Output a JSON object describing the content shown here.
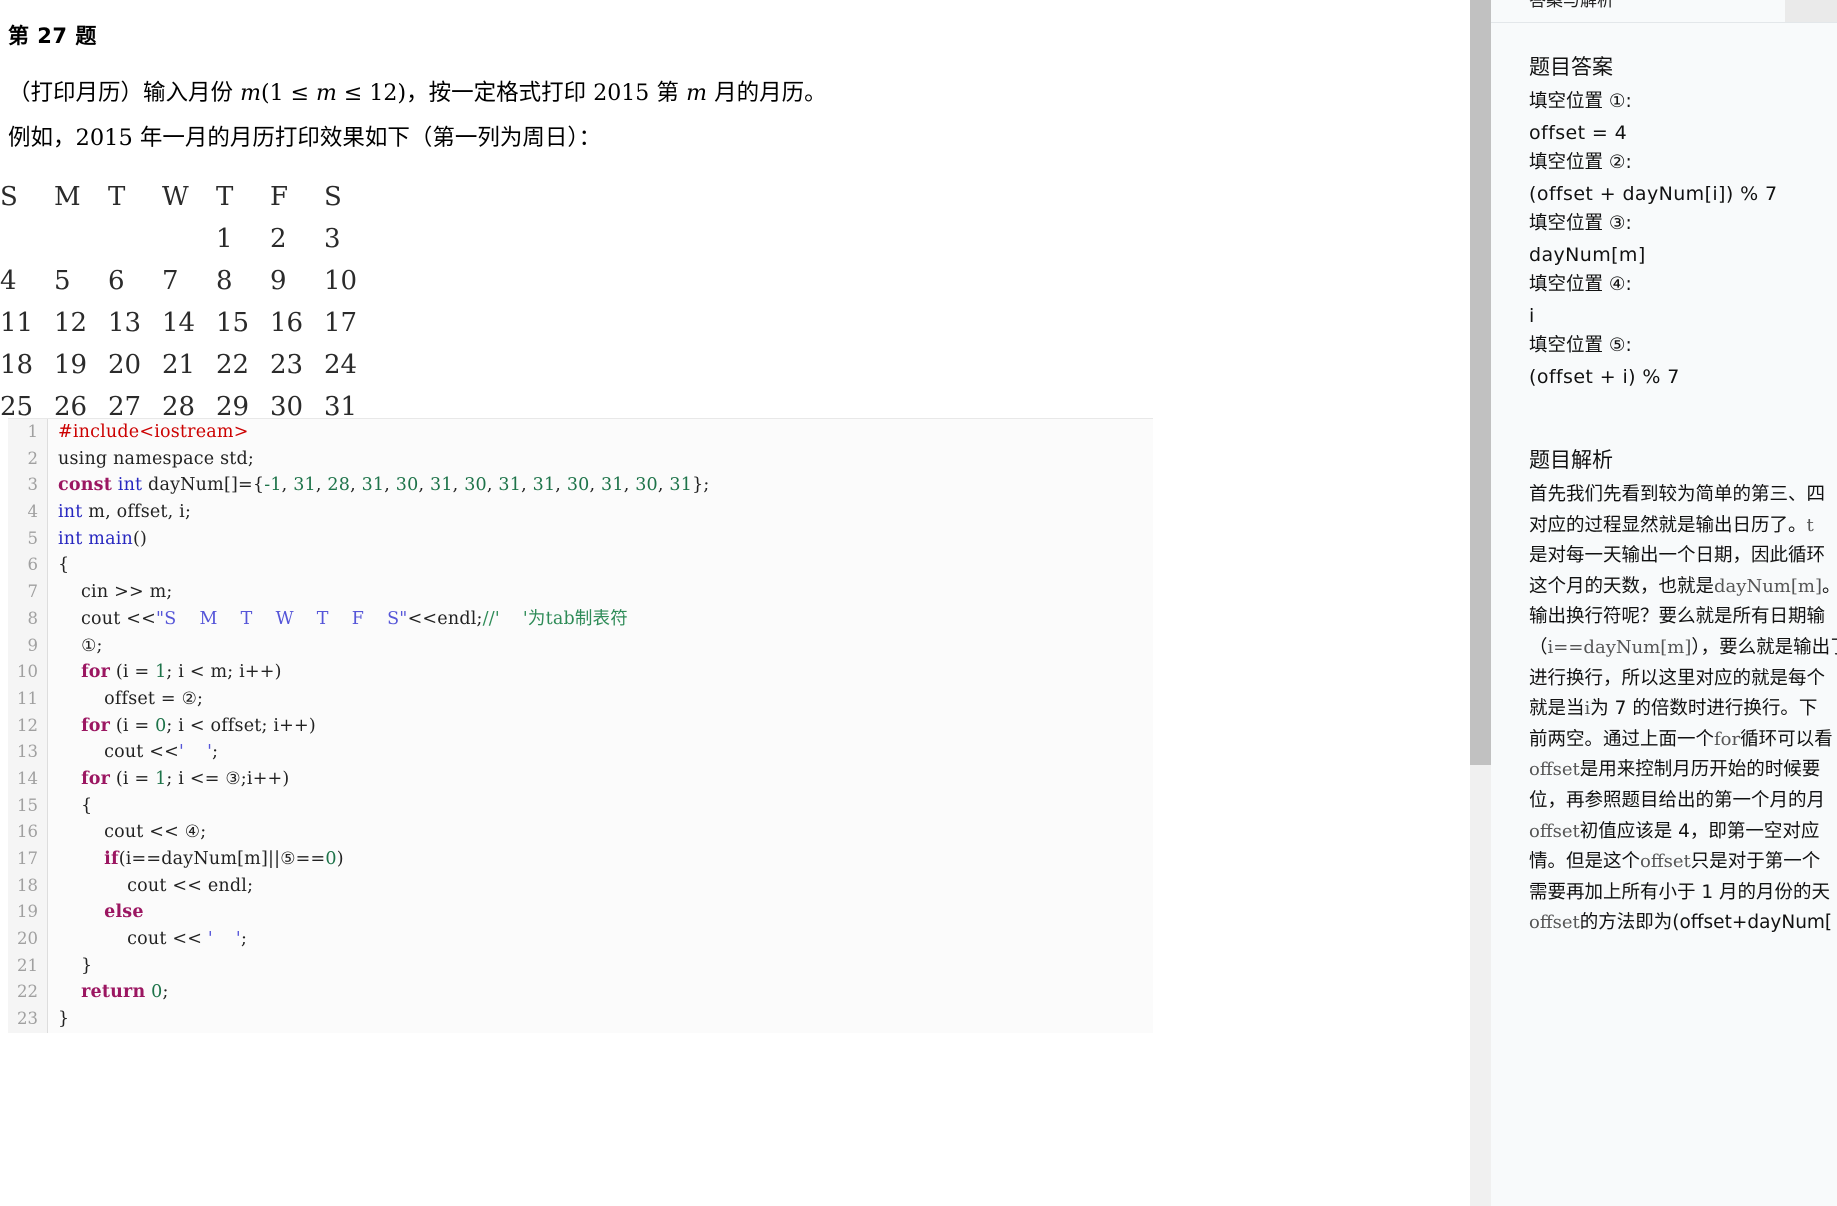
{
  "question": {
    "title": "第 27 题",
    "prompt_parts": {
      "p1_a": "（打印月历）输入月份 ",
      "p1_m": "m",
      "p1_b": "(",
      "p1_range": "1 ≤ m ≤ 12",
      "p1_c": ")，按一定格式打印 ",
      "p1_year": "2015",
      "p1_d": " 第 ",
      "p1_m2": "m",
      "p1_e": " 月的月历。"
    },
    "prompt_line2": "例如，2015 年一月的月历打印效果如下（第一列为周日）："
  },
  "calendar": {
    "header": [
      "S",
      "M",
      "T",
      "W",
      "T",
      "F",
      "S"
    ],
    "rows": [
      [
        "",
        "",
        "",
        "",
        "1",
        "2",
        "3"
      ],
      [
        "4",
        "5",
        "6",
        "7",
        "8",
        "9",
        "10"
      ],
      [
        "11",
        "12",
        "13",
        "14",
        "15",
        "16",
        "17"
      ],
      [
        "18",
        "19",
        "20",
        "21",
        "22",
        "23",
        "24"
      ],
      [
        "25",
        "26",
        "27",
        "28",
        "29",
        "30",
        "31"
      ]
    ]
  },
  "code": {
    "language": "cpp",
    "lines": [
      {
        "n": "1",
        "tokens": [
          {
            "t": "#include<iostream>",
            "c": "k-pre"
          }
        ]
      },
      {
        "n": "2",
        "tokens": [
          {
            "t": "using namespace std;",
            "c": ""
          }
        ]
      },
      {
        "n": "3",
        "tokens": [
          {
            "t": "const",
            "c": "k-kw"
          },
          {
            "t": " ",
            "c": ""
          },
          {
            "t": "int",
            "c": "k-type"
          },
          {
            "t": " dayNum[]={",
            "c": ""
          },
          {
            "t": "-1",
            "c": "k-num"
          },
          {
            "t": ", ",
            "c": ""
          },
          {
            "t": "31",
            "c": "k-num"
          },
          {
            "t": ", ",
            "c": ""
          },
          {
            "t": "28",
            "c": "k-num"
          },
          {
            "t": ", ",
            "c": ""
          },
          {
            "t": "31",
            "c": "k-num"
          },
          {
            "t": ", ",
            "c": ""
          },
          {
            "t": "30",
            "c": "k-num"
          },
          {
            "t": ", ",
            "c": ""
          },
          {
            "t": "31",
            "c": "k-num"
          },
          {
            "t": ", ",
            "c": ""
          },
          {
            "t": "30",
            "c": "k-num"
          },
          {
            "t": ", ",
            "c": ""
          },
          {
            "t": "31",
            "c": "k-num"
          },
          {
            "t": ", ",
            "c": ""
          },
          {
            "t": "31",
            "c": "k-num"
          },
          {
            "t": ", ",
            "c": ""
          },
          {
            "t": "30",
            "c": "k-num"
          },
          {
            "t": ", ",
            "c": ""
          },
          {
            "t": "31",
            "c": "k-num"
          },
          {
            "t": ", ",
            "c": ""
          },
          {
            "t": "30",
            "c": "k-num"
          },
          {
            "t": ", ",
            "c": ""
          },
          {
            "t": "31",
            "c": "k-num"
          },
          {
            "t": "};",
            "c": ""
          }
        ]
      },
      {
        "n": "4",
        "tokens": [
          {
            "t": "int",
            "c": "k-type"
          },
          {
            "t": " m, offset, i;",
            "c": ""
          }
        ]
      },
      {
        "n": "5",
        "tokens": [
          {
            "t": "int",
            "c": "k-type"
          },
          {
            "t": " ",
            "c": ""
          },
          {
            "t": "main",
            "c": "k-type"
          },
          {
            "t": "()",
            "c": ""
          }
        ]
      },
      {
        "n": "6",
        "tokens": [
          {
            "t": "{",
            "c": ""
          }
        ]
      },
      {
        "n": "7",
        "tokens": [
          {
            "t": "    cin >> m;",
            "c": ""
          }
        ]
      },
      {
        "n": "8",
        "tokens": [
          {
            "t": "    cout <<",
            "c": ""
          },
          {
            "t": "\"S\tM\tT\tW\tT\tF\tS\"",
            "c": "k-str"
          },
          {
            "t": "<<endl;",
            "c": ""
          },
          {
            "t": "//'\t'为tab制表符",
            "c": "k-cmt"
          }
        ]
      },
      {
        "n": "9",
        "tokens": [
          {
            "t": "    ",
            "c": ""
          },
          {
            "t": "①",
            "c": "circ"
          },
          {
            "t": ";",
            "c": ""
          }
        ]
      },
      {
        "n": "10",
        "tokens": [
          {
            "t": "    ",
            "c": ""
          },
          {
            "t": "for",
            "c": "k-kw"
          },
          {
            "t": " (i = ",
            "c": ""
          },
          {
            "t": "1",
            "c": "k-num"
          },
          {
            "t": "; i < m; i++)",
            "c": ""
          }
        ]
      },
      {
        "n": "11",
        "tokens": [
          {
            "t": "        offset = ",
            "c": ""
          },
          {
            "t": "②",
            "c": "circ"
          },
          {
            "t": ";",
            "c": ""
          }
        ]
      },
      {
        "n": "12",
        "tokens": [
          {
            "t": "    ",
            "c": ""
          },
          {
            "t": "for",
            "c": "k-kw"
          },
          {
            "t": " (i = ",
            "c": ""
          },
          {
            "t": "0",
            "c": "k-num"
          },
          {
            "t": "; i < offset; i++)",
            "c": ""
          }
        ]
      },
      {
        "n": "13",
        "tokens": [
          {
            "t": "        cout <<",
            "c": ""
          },
          {
            "t": "'\t'",
            "c": "k-str"
          },
          {
            "t": ";",
            "c": ""
          }
        ]
      },
      {
        "n": "14",
        "tokens": [
          {
            "t": "    ",
            "c": ""
          },
          {
            "t": "for",
            "c": "k-kw"
          },
          {
            "t": " (i = ",
            "c": ""
          },
          {
            "t": "1",
            "c": "k-num"
          },
          {
            "t": "; i <= ",
            "c": ""
          },
          {
            "t": "③",
            "c": "circ"
          },
          {
            "t": ";i++)",
            "c": ""
          }
        ]
      },
      {
        "n": "15",
        "tokens": [
          {
            "t": "    {",
            "c": ""
          }
        ]
      },
      {
        "n": "16",
        "tokens": [
          {
            "t": "        cout << ",
            "c": ""
          },
          {
            "t": "④",
            "c": "circ"
          },
          {
            "t": ";",
            "c": ""
          }
        ]
      },
      {
        "n": "17",
        "tokens": [
          {
            "t": "        ",
            "c": ""
          },
          {
            "t": "if",
            "c": "k-kw"
          },
          {
            "t": "(i==dayNum[m]||",
            "c": ""
          },
          {
            "t": "⑤",
            "c": "circ"
          },
          {
            "t": "==",
            "c": ""
          },
          {
            "t": "0",
            "c": "k-num"
          },
          {
            "t": ")",
            "c": ""
          }
        ]
      },
      {
        "n": "18",
        "tokens": [
          {
            "t": "            cout << endl;",
            "c": ""
          }
        ]
      },
      {
        "n": "19",
        "tokens": [
          {
            "t": "        ",
            "c": ""
          },
          {
            "t": "else",
            "c": "k-kw"
          }
        ]
      },
      {
        "n": "20",
        "tokens": [
          {
            "t": "            cout << ",
            "c": ""
          },
          {
            "t": "'\t'",
            "c": "k-str"
          },
          {
            "t": ";",
            "c": ""
          }
        ]
      },
      {
        "n": "21",
        "tokens": [
          {
            "t": "    }",
            "c": ""
          }
        ]
      },
      {
        "n": "22",
        "tokens": [
          {
            "t": "    ",
            "c": ""
          },
          {
            "t": "return",
            "c": "k-kw"
          },
          {
            "t": " ",
            "c": ""
          },
          {
            "t": "0",
            "c": "k-num"
          },
          {
            "t": ";",
            "c": ""
          }
        ]
      },
      {
        "n": "23",
        "tokens": [
          {
            "t": "}",
            "c": ""
          }
        ]
      }
    ]
  },
  "panel": {
    "tab_active": "答案与解析",
    "answer_heading": "题目答案",
    "answers": [
      {
        "label": "填空位置 ①:",
        "value": "offset = 4"
      },
      {
        "label": "填空位置 ②:",
        "value": "(offset + dayNum[i]) % 7"
      },
      {
        "label": "填空位置 ③:",
        "value": "dayNum[m]"
      },
      {
        "label": "填空位置 ④:",
        "value": "i"
      },
      {
        "label": "填空位置 ⑤:",
        "value": "(offset + i) % 7"
      }
    ],
    "analysis_heading": "题目解析",
    "analysis_lines": [
      "首先我们先看到较为简单的第三、四",
      "对应的过程显然就是输出日历了。t",
      "是对每一天输出一个日期，因此循环",
      "这个月的天数，也就是dayNum[m]。",
      "输出换行符呢？要么就是所有日期输",
      "（i==dayNum[m]），要么就是输出了",
      "进行换行，所以这里对应的就是每个",
      "就是当i为 7 的倍数时进行换行。下",
      "前两空。通过上面一个for循环可以看",
      "offset是用来控制月历开始的时候要",
      "位，再参照题目给出的第一个月的月",
      "offset初值应该是 4，即第一空对应",
      "情。但是这个offset只是对于第一个",
      "需要再加上所有小于 1 月的月份的天",
      "offset的方法即为(offset+dayNum["
    ]
  },
  "colors": {
    "preprocessor": "#cc0000",
    "keyword": "#9b1661",
    "type": "#2727c0",
    "number": "#1d7349",
    "string": "#5555d8",
    "comment": "#2e8b57",
    "panel_bg": "#f8fafb",
    "scroll_thumb": "#c1c1c1",
    "scroll_track": "#f0f0f0"
  }
}
